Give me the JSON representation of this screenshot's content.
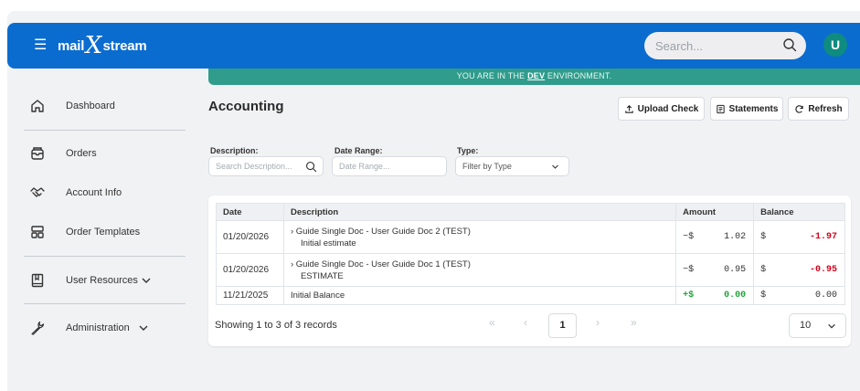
{
  "header": {
    "logo_left": "mail",
    "logo_x": "X",
    "logo_right": "stream",
    "search_placeholder": "Search...",
    "avatar_letter": "U",
    "brand_color": "#0b6ccf"
  },
  "sidebar": {
    "items": [
      {
        "label": "Dashboard",
        "icon": "home-icon"
      },
      {
        "label": "Orders",
        "icon": "orders-icon"
      },
      {
        "label": "Account Info",
        "icon": "handshake-icon"
      },
      {
        "label": "Order Templates",
        "icon": "template-icon"
      },
      {
        "label": "User Resources",
        "icon": "book-icon",
        "chevron": "chevron-down-icon"
      },
      {
        "label": "Administration",
        "icon": "wrench-icon",
        "chevron": "chevron-down-icon"
      }
    ]
  },
  "env_banner": {
    "prefix": "YOU ARE IN THE",
    "env": "DEV",
    "suffix": "ENVIRONMENT."
  },
  "page": {
    "title": "Accounting",
    "buttons": {
      "upload": "Upload Check",
      "statements": "Statements",
      "refresh": "Refresh"
    }
  },
  "filters": {
    "description_label": "Description:",
    "description_placeholder": "Search Description...",
    "date_label": "Date Range:",
    "date_placeholder": "Date Range...",
    "type_label": "Type:",
    "type_value": "Filter by Type"
  },
  "table": {
    "columns": [
      "Date",
      "Description",
      "Amount",
      "Balance"
    ],
    "rows": [
      {
        "date": "01/20/2026",
        "desc1": "Guide Single Doc - User Guide Doc 2 (TEST)",
        "desc2": "Initial estimate",
        "amt_sign": "−$",
        "amt": "1.02",
        "bal_sign": "$",
        "bal": "-1.97",
        "bal_state": "neg"
      },
      {
        "date": "01/20/2026",
        "desc1": "Guide Single Doc - User Guide Doc 1 (TEST)",
        "desc2": "ESTIMATE",
        "amt_sign": "−$",
        "amt": "0.95",
        "bal_sign": "$",
        "bal": "-0.95",
        "bal_state": "neg"
      },
      {
        "date": "11/21/2025",
        "desc1": "Initial Balance",
        "desc2": "",
        "amt_sign": "+$",
        "amt": "0.00",
        "bal_sign": "$",
        "bal": "0.00",
        "bal_state": "zero"
      }
    ]
  },
  "footer": {
    "showing": "Showing 1 to 3 of 3 records",
    "first": "«",
    "prev": "‹",
    "current_page": "1",
    "next": "›",
    "last": "»",
    "page_size": "10"
  },
  "colors": {
    "env_banner": "#2f9c8c",
    "negative": "#d0021b",
    "positive": "#1fa33a",
    "avatar": "#0e8c7f"
  }
}
